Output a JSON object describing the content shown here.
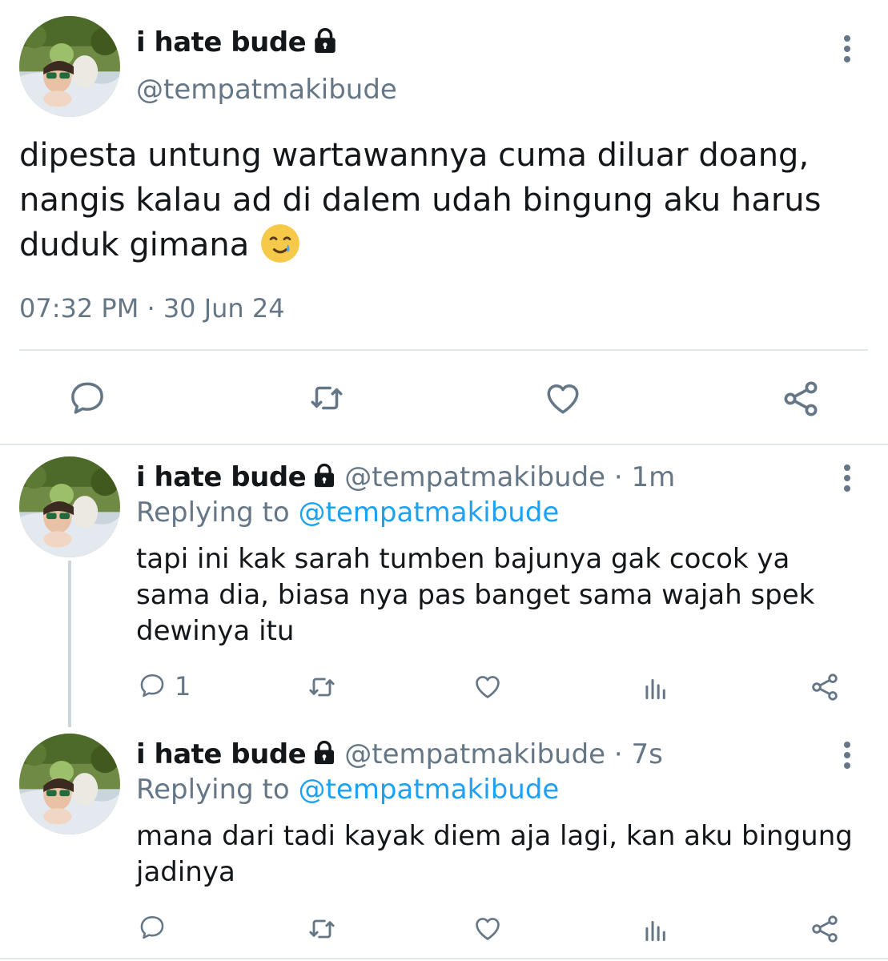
{
  "colors": {
    "text": "#14171a",
    "secondary": "#657786",
    "link": "#1da1f2",
    "divider": "#e1e8ed"
  },
  "main_tweet": {
    "name": "i hate bude",
    "handle": "@tempatmakibude",
    "text": "dipesta untung wartawannya cuma diluar doang, nangis kalau ad di dalem udah bingung aku harus duduk gimana",
    "emoji": "🥲",
    "timestamp": "07:32 PM · 30 Jun 24",
    "actions": [
      "reply-icon",
      "retweet-icon",
      "like-icon",
      "share-icon"
    ]
  },
  "replies": [
    {
      "name": "i hate bude",
      "meta": "@tempatmakibude · 1m",
      "replying_label": "Replying to",
      "replying_mention": "@tempatmakibude",
      "text": "tapi ini kak sarah tumben bajunya gak cocok ya sama dia, biasa nya pas banget sama wajah spek dewinya itu",
      "reply_count": "1",
      "actions": [
        "reply-icon",
        "retweet-icon",
        "like-icon",
        "analytics-icon",
        "share-icon"
      ]
    },
    {
      "name": "i hate bude",
      "meta": "@tempatmakibude · 7s",
      "replying_label": "Replying to",
      "replying_mention": "@tempatmakibude",
      "text": "mana dari tadi kayak diem aja lagi, kan aku bingung jadinya",
      "reply_count": "",
      "actions": [
        "reply-icon",
        "retweet-icon",
        "like-icon",
        "analytics-icon",
        "share-icon"
      ]
    }
  ]
}
